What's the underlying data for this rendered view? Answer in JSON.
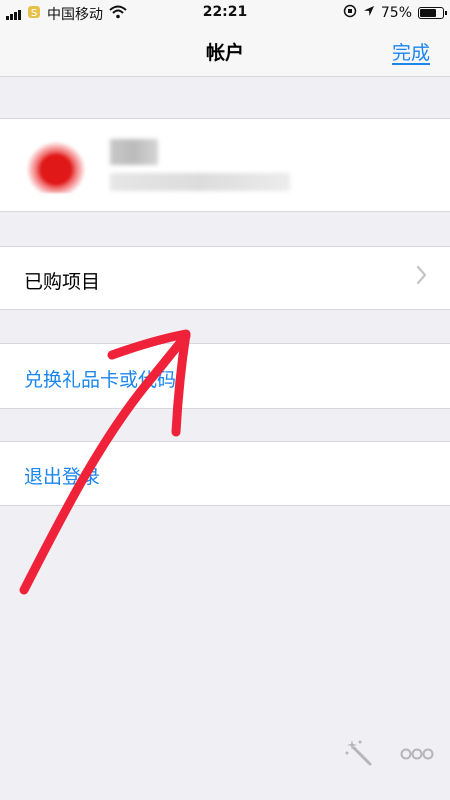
{
  "status_bar": {
    "carrier": "中国移动",
    "time": "22:21",
    "battery": "75%",
    "battery_level": 0.75
  },
  "nav": {
    "title": "帐户",
    "done_label": "完成"
  },
  "rows": {
    "purchases_label": "已购项目",
    "redeem_label": "兑换礼品卡或代码",
    "signout_label": "退出登录"
  },
  "colors": {
    "accent": "#1a86f0",
    "background": "#efeff4",
    "annotation_arrow": "#f0223a"
  },
  "icons": {
    "chevron": "chevron-right-icon",
    "magic": "magic-wand-icon",
    "more": "more-dots-icon"
  }
}
